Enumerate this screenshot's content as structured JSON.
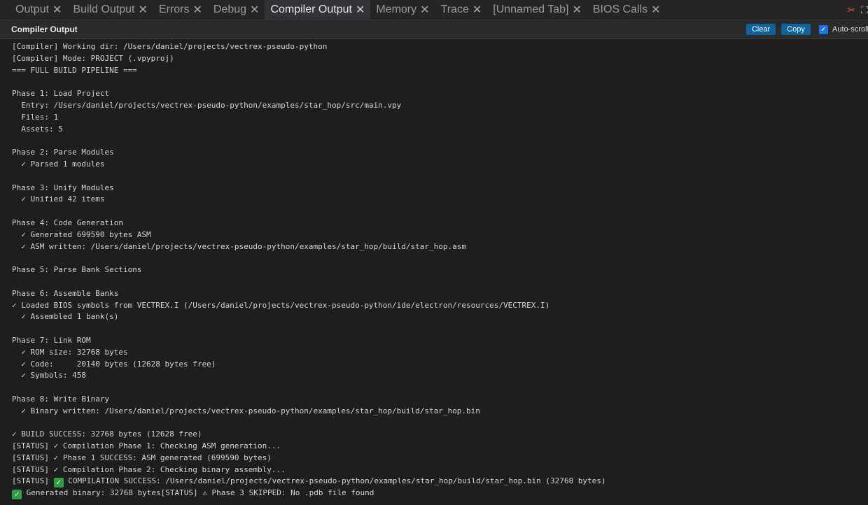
{
  "tabs": [
    {
      "label": "Output",
      "active": false
    },
    {
      "label": "Build Output",
      "active": false
    },
    {
      "label": "Errors",
      "active": false
    },
    {
      "label": "Debug",
      "active": false
    },
    {
      "label": "Compiler Output",
      "active": true
    },
    {
      "label": "Memory",
      "active": false
    },
    {
      "label": "Trace",
      "active": false
    },
    {
      "label": "[Unnamed Tab]",
      "active": false
    },
    {
      "label": "BIOS Calls",
      "active": false
    }
  ],
  "tab_close_glyph": "✕",
  "panel": {
    "title": "Compiler Output",
    "clear_label": "Clear",
    "copy_label": "Copy",
    "autoscroll_label": "Auto-scroll",
    "autoscroll_checked": true
  },
  "icons": {
    "pin": "pin-off-icon",
    "expand": "maximize-icon"
  },
  "lines": [
    "[Compiler] Working dir: /Users/daniel/projects/vectrex-pseudo-python",
    "[Compiler] Mode: PROJECT (.vpyproj)",
    "=== FULL BUILD PIPELINE ===",
    "",
    "Phase 1: Load Project",
    "  Entry: /Users/daniel/projects/vectrex-pseudo-python/examples/star_hop/src/main.vpy",
    "  Files: 1",
    "  Assets: 5",
    "",
    "Phase 2: Parse Modules",
    "  ✓ Parsed 1 modules",
    "",
    "Phase 3: Unify Modules",
    "  ✓ Unified 42 items",
    "",
    "Phase 4: Code Generation",
    "  ✓ Generated 699590 bytes ASM",
    "  ✓ ASM written: /Users/daniel/projects/vectrex-pseudo-python/examples/star_hop/build/star_hop.asm",
    "",
    "Phase 5: Parse Bank Sections",
    "",
    "Phase 6: Assemble Banks",
    "✓ Loaded BIOS symbols from VECTREX.I (/Users/daniel/projects/vectrex-pseudo-python/ide/electron/resources/VECTREX.I)",
    "  ✓ Assembled 1 bank(s)",
    "",
    "Phase 7: Link ROM",
    "  ✓ ROM size: 32768 bytes",
    "  ✓ Code:     20140 bytes (12628 bytes free)",
    "  ✓ Symbols: 458",
    "",
    "Phase 8: Write Binary",
    "  ✓ Binary written: /Users/daniel/projects/vectrex-pseudo-python/examples/star_hop/build/star_hop.bin",
    "",
    "✓ BUILD SUCCESS: 32768 bytes (12628 free)",
    "[STATUS] ✓ Compilation Phase 1: Checking ASM generation...",
    "[STATUS] ✓ Phase 1 SUCCESS: ASM generated (699590 bytes)",
    "[STATUS] ✓ Compilation Phase 2: Checking binary assembly...",
    "[STATUS] ✅ COMPILATION SUCCESS: /Users/daniel/projects/vectrex-pseudo-python/examples/star_hop/build/star_hop.bin (32768 bytes)",
    "✅ Generated binary: 32768 bytes[STATUS] ⚠ Phase 3 SKIPPED: No .pdb file found"
  ]
}
